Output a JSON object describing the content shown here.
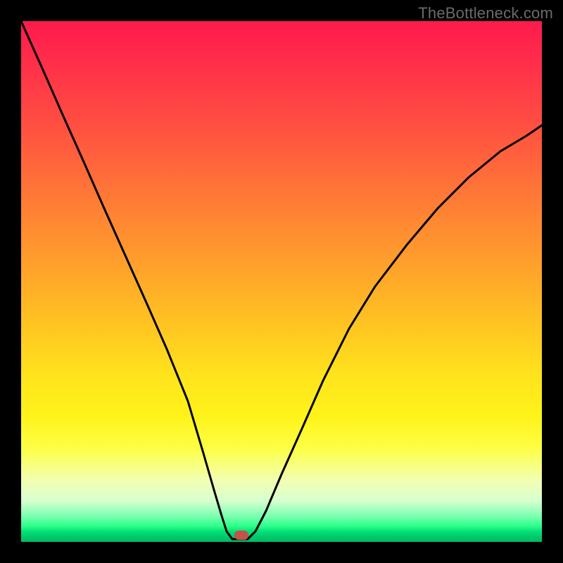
{
  "watermark": "TheBottleneck.com",
  "chart_data": {
    "type": "line",
    "title": "",
    "xlabel": "",
    "ylabel": "",
    "xlim": [
      0,
      100
    ],
    "ylim": [
      0,
      100
    ],
    "grid": false,
    "legend": false,
    "series": [
      {
        "name": "left-branch",
        "x": [
          0,
          4,
          8,
          12,
          16,
          20,
          24,
          28,
          32,
          35,
          37,
          38.5,
          39.5,
          40.5
        ],
        "values": [
          100,
          91,
          82,
          73,
          64,
          55,
          46,
          37,
          27,
          17,
          10,
          5,
          2,
          0.5
        ]
      },
      {
        "name": "floor",
        "x": [
          40.5,
          43.5
        ],
        "values": [
          0.5,
          0.5
        ]
      },
      {
        "name": "right-branch",
        "x": [
          43.5,
          45,
          47,
          50,
          54,
          58,
          63,
          68,
          74,
          80,
          86,
          92,
          97,
          100
        ],
        "values": [
          0.5,
          2,
          6,
          13,
          22,
          31,
          41,
          49,
          57,
          64,
          70,
          75,
          78,
          80
        ]
      }
    ],
    "marker": {
      "x": 42.5,
      "y": 0.5,
      "color": "#c4514a"
    },
    "background_gradient": {
      "direction": "vertical",
      "stops": [
        {
          "pos": 0,
          "color": "#ff1a4d"
        },
        {
          "pos": 50,
          "color": "#ffb327"
        },
        {
          "pos": 80,
          "color": "#fff31a"
        },
        {
          "pos": 100,
          "color": "#01b963"
        }
      ]
    }
  }
}
